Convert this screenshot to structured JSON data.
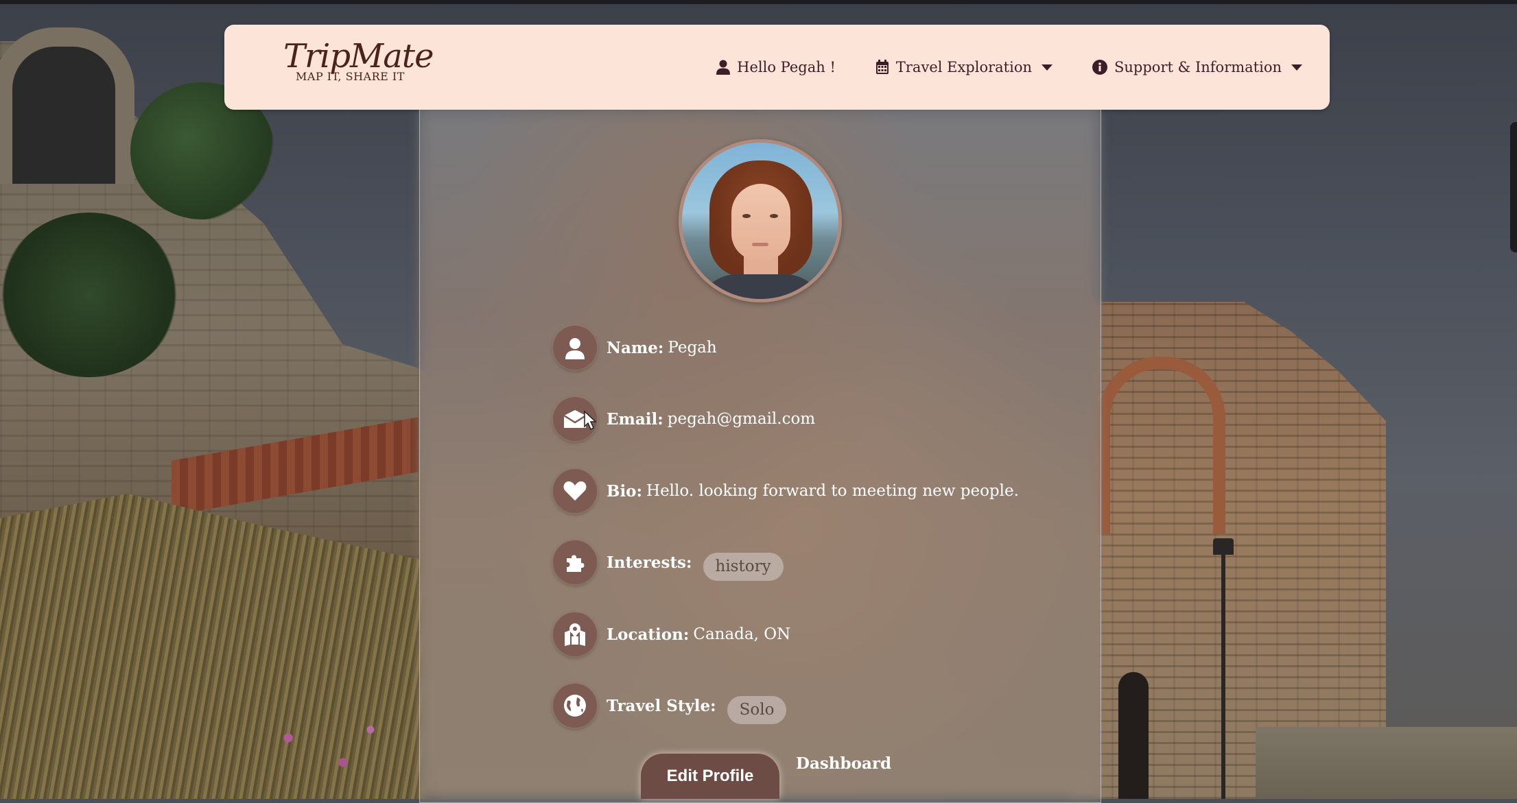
{
  "brand": {
    "name": "TripMate",
    "tagline": "MAP IT, SHARE IT"
  },
  "nav": {
    "greeting": "Hello Pegah !",
    "travel_exploration": "Travel Exploration",
    "support_information": "Support & Information"
  },
  "profile": {
    "name_label": "Name:",
    "name_value": "Pegah",
    "email_label": "Email:",
    "email_value": "pegah@gmail.com",
    "bio_label": "Bio:",
    "bio_value": "Hello. looking forward to meeting new people.",
    "interests_label": "Interests:",
    "interests": [
      "history"
    ],
    "location_label": "Location:",
    "location_value": "Canada, ON",
    "travel_style_label": "Travel Style:",
    "travel_style": "Solo"
  },
  "actions": {
    "edit_profile": "Edit Profile",
    "dashboard": "Dashboard"
  },
  "colors": {
    "navbar_bg": "#fde4d8",
    "accent": "#6e4c46",
    "nav_text": "#3b1e28",
    "icon_bg": "#7d5a52"
  },
  "icons": [
    "user-icon",
    "calendar-icon",
    "info-icon",
    "caret-down-icon",
    "envelope-icon",
    "heart-icon",
    "puzzle-icon",
    "map-pin-icon",
    "globe-icon"
  ]
}
